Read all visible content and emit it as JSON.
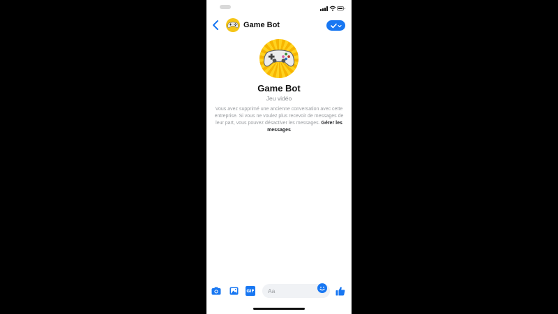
{
  "header": {
    "title": "Game Bot"
  },
  "profile": {
    "name": "Game Bot",
    "category": "Jeu vidéo"
  },
  "notice": {
    "text": "Vous avez supprimé une ancienne conversation avec cette entreprise. Si vous ne voulez plus recevoir de messages de leur part, vous pouvez désactiver les messages.",
    "link": "Gérer les messages"
  },
  "composer": {
    "placeholder": "Aa",
    "gif_label": "GIF"
  },
  "icons": {
    "back": "chevron-left-icon",
    "done": "check-icon",
    "camera": "camera-icon",
    "gallery": "image-icon",
    "gif": "gif-icon",
    "emoji": "emoji-icon",
    "like": "thumbs-up-icon",
    "avatar": "gamepad-icon"
  },
  "colors": {
    "accent": "#1877f2",
    "avatar_background": "#f5c518",
    "notice_text": "#9a9da1"
  }
}
